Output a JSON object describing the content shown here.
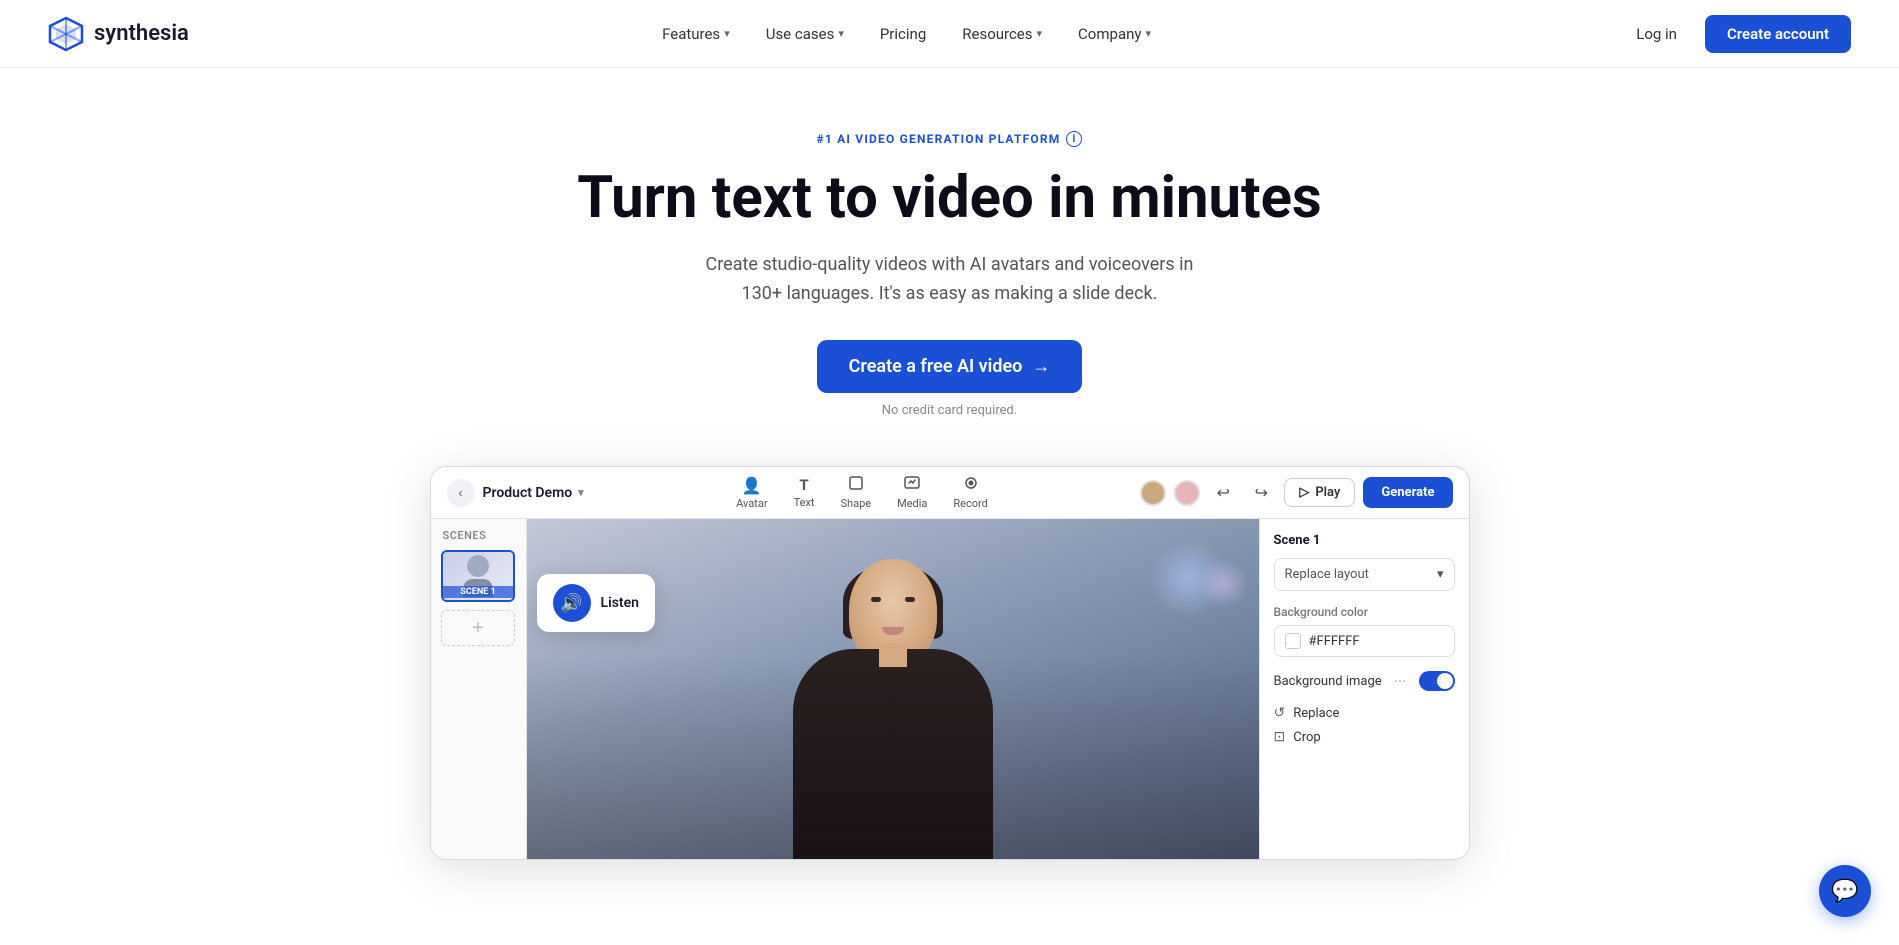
{
  "brand": {
    "name": "synthesia",
    "logo_hex": "#1a4fd6"
  },
  "navbar": {
    "logo_text": "synthesia",
    "links": [
      {
        "id": "features",
        "label": "Features",
        "has_dropdown": true
      },
      {
        "id": "use-cases",
        "label": "Use cases",
        "has_dropdown": true
      },
      {
        "id": "pricing",
        "label": "Pricing",
        "has_dropdown": false
      },
      {
        "id": "resources",
        "label": "Resources",
        "has_dropdown": true
      },
      {
        "id": "company",
        "label": "Company",
        "has_dropdown": true
      }
    ],
    "login_label": "Log in",
    "create_account_label": "Create account"
  },
  "hero": {
    "badge_text": "#1 AI VIDEO GENERATION PLATFORM",
    "title": "Turn text to video in minutes",
    "subtitle": "Create studio-quality videos with AI avatars and voiceovers in 130+ languages. It's as easy as making a slide deck.",
    "cta_label": "Create a free AI video",
    "disclaimer": "No credit card required."
  },
  "product": {
    "project_name": "Product Demo",
    "toolbar_tools": [
      {
        "id": "avatar",
        "label": "Avatar",
        "icon": "👤"
      },
      {
        "id": "text",
        "label": "Text",
        "icon": "T"
      },
      {
        "id": "shape",
        "label": "Shape",
        "icon": "⬜"
      },
      {
        "id": "media",
        "label": "Media",
        "icon": "🖼"
      },
      {
        "id": "record",
        "label": "Record",
        "icon": "⏺"
      }
    ],
    "play_label": "Play",
    "generate_label": "Generate",
    "scenes_label": "Scenes",
    "scene1_label": "SCENE 1",
    "add_scene_label": "+",
    "listen_text": "Listen",
    "right_panel": {
      "section_title": "Scene 1",
      "replace_layout_label": "Replace layout",
      "background_color_label": "Background color",
      "background_color_value": "#FFFFFF",
      "background_image_label": "Background image",
      "replace_label": "Replace",
      "crop_label": "Crop"
    }
  },
  "chat": {
    "icon": "💬"
  }
}
